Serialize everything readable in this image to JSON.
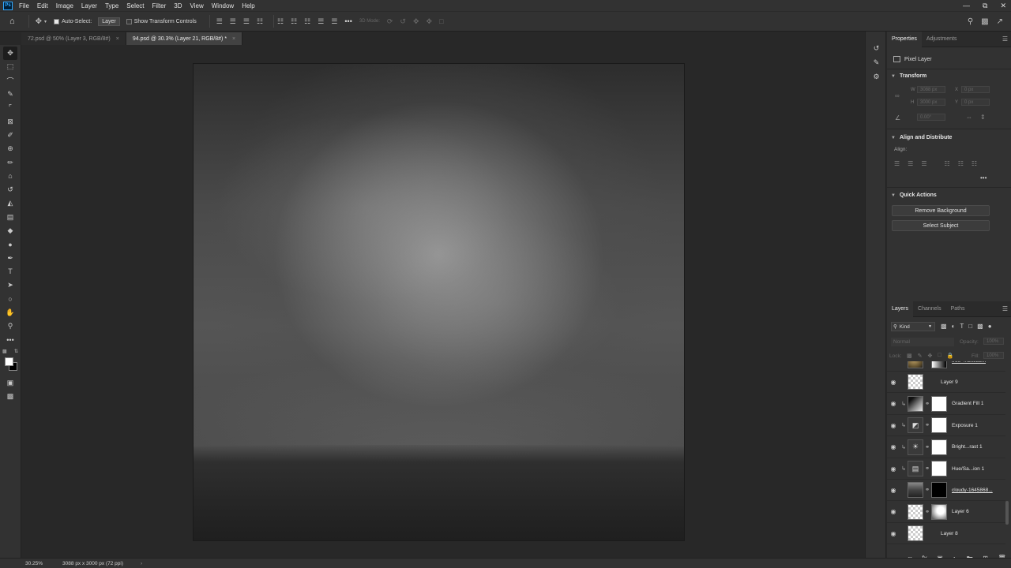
{
  "menubar": {
    "app_logo": "Ps",
    "items": [
      "File",
      "Edit",
      "Image",
      "Layer",
      "Type",
      "Select",
      "Filter",
      "3D",
      "View",
      "Window",
      "Help"
    ],
    "window_controls": [
      "—",
      "⧉",
      "✕"
    ]
  },
  "options": {
    "auto_select_label": "Auto-Select:",
    "auto_select_target": "Layer",
    "transform_controls_label": "Show Transform Controls",
    "mode_3d_label": "3D Mode:",
    "more_label": "•••"
  },
  "tabs": [
    {
      "label": "72.psd @ 50% (Layer 3, RGB/8#)",
      "close": "×",
      "active": false
    },
    {
      "label": "94.psd @ 30.3% (Layer 21, RGB/8#) *",
      "close": "×",
      "active": true
    }
  ],
  "tools": [
    {
      "name": "move-tool-icon",
      "glyph": "✥"
    },
    {
      "name": "marquee-tool-icon",
      "glyph": "⬚"
    },
    {
      "name": "lasso-tool-icon",
      "glyph": "⌒"
    },
    {
      "name": "quick-select-tool-icon",
      "glyph": "✎"
    },
    {
      "name": "crop-tool-icon",
      "glyph": "⌜"
    },
    {
      "name": "frame-tool-icon",
      "glyph": "⊠"
    },
    {
      "name": "eyedropper-tool-icon",
      "glyph": "✐"
    },
    {
      "name": "healing-brush-tool-icon",
      "glyph": "⊕"
    },
    {
      "name": "brush-tool-icon",
      "glyph": "✏"
    },
    {
      "name": "clone-stamp-tool-icon",
      "glyph": "⌂"
    },
    {
      "name": "history-brush-tool-icon",
      "glyph": "↺"
    },
    {
      "name": "eraser-tool-icon",
      "glyph": "◭"
    },
    {
      "name": "gradient-tool-icon",
      "glyph": "▤"
    },
    {
      "name": "blur-tool-icon",
      "glyph": "◆"
    },
    {
      "name": "dodge-tool-icon",
      "glyph": "●"
    },
    {
      "name": "pen-tool-icon",
      "glyph": "✒"
    },
    {
      "name": "type-tool-icon",
      "glyph": "T"
    },
    {
      "name": "path-select-tool-icon",
      "glyph": "➤"
    },
    {
      "name": "shape-tool-icon",
      "glyph": "○"
    },
    {
      "name": "hand-tool-icon",
      "glyph": "✋"
    },
    {
      "name": "zoom-tool-icon",
      "glyph": "⚲"
    },
    {
      "name": "edit-toolbar-icon",
      "glyph": "•••"
    }
  ],
  "colors": {
    "foreground": "#ffffff",
    "background": "#000000",
    "app_bg": "#282828",
    "panel_bg": "#323232"
  },
  "properties": {
    "tab_properties": "Properties",
    "tab_adjustments": "Adjustments",
    "layer_kind": "Pixel Layer",
    "transform_title": "Transform",
    "w_label": "W",
    "w_value": "3088 px",
    "h_label": "H",
    "h_value": "3000 px",
    "x_label": "X",
    "x_value": "0 px",
    "y_label": "Y",
    "y_value": "0 px",
    "angle_value": "0.00°",
    "align_title": "Align and Distribute",
    "align_label": "Align:",
    "align_more": "•••",
    "quick_actions_title": "Quick Actions",
    "remove_bg_button": "Remove Background",
    "select_subject_button": "Select Subject"
  },
  "layers_panel": {
    "tab_layers": "Layers",
    "tab_channels": "Channels",
    "tab_paths": "Paths",
    "filter_kind": "Kind",
    "blend_mode": "Normal",
    "opacity_label": "Opacity:",
    "opacity_value": "100%",
    "lock_label": "Lock:",
    "fill_label": "Fill:",
    "fill_value": "100%",
    "layers": [
      {
        "name": "free_...3k9b3...",
        "visible": false,
        "clip": false,
        "thumb": "photo",
        "mask": "gradient",
        "underline": true
      },
      {
        "name": "Layer 9",
        "visible": true,
        "clip": false,
        "thumb": "checker",
        "mask": null,
        "underline": false
      },
      {
        "name": "Gradient Fill 1",
        "visible": true,
        "clip": true,
        "thumb": "gradient",
        "mask": "white",
        "underline": false
      },
      {
        "name": "Exposure 1",
        "visible": true,
        "clip": true,
        "thumb": "adj-exposure",
        "mask": "white",
        "underline": false
      },
      {
        "name": "Bright...rast 1",
        "visible": true,
        "clip": true,
        "thumb": "adj-brightness",
        "mask": "white",
        "underline": false
      },
      {
        "name": "Hue/Sa...ion 1",
        "visible": true,
        "clip": true,
        "thumb": "adj-hue",
        "mask": "white",
        "underline": false
      },
      {
        "name": "cloudy-1645868...",
        "visible": true,
        "clip": false,
        "thumb": "dark-photo",
        "mask": "black",
        "underline": true
      },
      {
        "name": "Layer 6",
        "visible": true,
        "clip": false,
        "thumb": "checker",
        "mask": "soft",
        "underline": false
      },
      {
        "name": "Layer 8",
        "visible": true,
        "clip": false,
        "thumb": "checker",
        "mask": null,
        "underline": false
      }
    ]
  },
  "status": {
    "zoom": "30.25%",
    "doc_info": "3088 px x 3000 px (72 ppi)",
    "arrow": "›"
  }
}
